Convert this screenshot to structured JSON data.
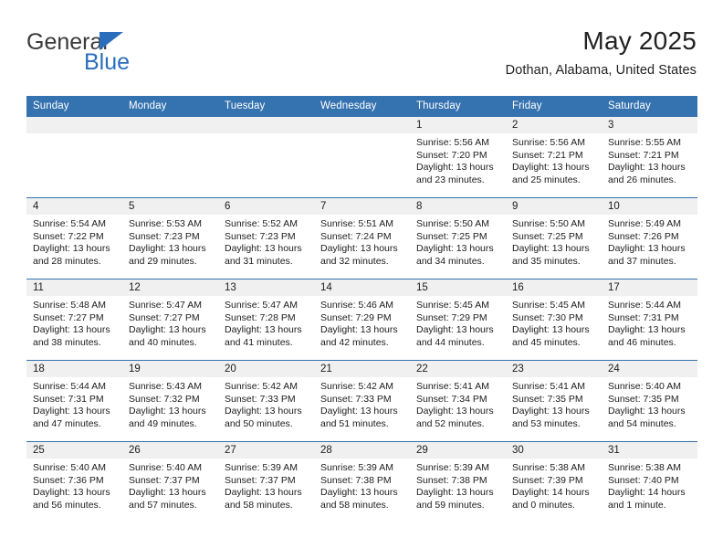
{
  "brand": {
    "name_top": "General",
    "name_bottom": "Blue",
    "accent_color": "#2a6ebb"
  },
  "header": {
    "title": "May 2025",
    "subtitle": "Dothan, Alabama, United States",
    "header_bg": "#3572b0",
    "header_text_color": "#ffffff"
  },
  "weekdays": [
    "Sunday",
    "Monday",
    "Tuesday",
    "Wednesday",
    "Thursday",
    "Friday",
    "Saturday"
  ],
  "weeks": [
    [
      {
        "day": "",
        "sunrise": "",
        "sunset": "",
        "daylight_1": "",
        "daylight_2": ""
      },
      {
        "day": "",
        "sunrise": "",
        "sunset": "",
        "daylight_1": "",
        "daylight_2": ""
      },
      {
        "day": "",
        "sunrise": "",
        "sunset": "",
        "daylight_1": "",
        "daylight_2": ""
      },
      {
        "day": "",
        "sunrise": "",
        "sunset": "",
        "daylight_1": "",
        "daylight_2": ""
      },
      {
        "day": "1",
        "sunrise": "Sunrise: 5:56 AM",
        "sunset": "Sunset: 7:20 PM",
        "daylight_1": "Daylight: 13 hours",
        "daylight_2": "and 23 minutes."
      },
      {
        "day": "2",
        "sunrise": "Sunrise: 5:56 AM",
        "sunset": "Sunset: 7:21 PM",
        "daylight_1": "Daylight: 13 hours",
        "daylight_2": "and 25 minutes."
      },
      {
        "day": "3",
        "sunrise": "Sunrise: 5:55 AM",
        "sunset": "Sunset: 7:21 PM",
        "daylight_1": "Daylight: 13 hours",
        "daylight_2": "and 26 minutes."
      }
    ],
    [
      {
        "day": "4",
        "sunrise": "Sunrise: 5:54 AM",
        "sunset": "Sunset: 7:22 PM",
        "daylight_1": "Daylight: 13 hours",
        "daylight_2": "and 28 minutes."
      },
      {
        "day": "5",
        "sunrise": "Sunrise: 5:53 AM",
        "sunset": "Sunset: 7:23 PM",
        "daylight_1": "Daylight: 13 hours",
        "daylight_2": "and 29 minutes."
      },
      {
        "day": "6",
        "sunrise": "Sunrise: 5:52 AM",
        "sunset": "Sunset: 7:23 PM",
        "daylight_1": "Daylight: 13 hours",
        "daylight_2": "and 31 minutes."
      },
      {
        "day": "7",
        "sunrise": "Sunrise: 5:51 AM",
        "sunset": "Sunset: 7:24 PM",
        "daylight_1": "Daylight: 13 hours",
        "daylight_2": "and 32 minutes."
      },
      {
        "day": "8",
        "sunrise": "Sunrise: 5:50 AM",
        "sunset": "Sunset: 7:25 PM",
        "daylight_1": "Daylight: 13 hours",
        "daylight_2": "and 34 minutes."
      },
      {
        "day": "9",
        "sunrise": "Sunrise: 5:50 AM",
        "sunset": "Sunset: 7:25 PM",
        "daylight_1": "Daylight: 13 hours",
        "daylight_2": "and 35 minutes."
      },
      {
        "day": "10",
        "sunrise": "Sunrise: 5:49 AM",
        "sunset": "Sunset: 7:26 PM",
        "daylight_1": "Daylight: 13 hours",
        "daylight_2": "and 37 minutes."
      }
    ],
    [
      {
        "day": "11",
        "sunrise": "Sunrise: 5:48 AM",
        "sunset": "Sunset: 7:27 PM",
        "daylight_1": "Daylight: 13 hours",
        "daylight_2": "and 38 minutes."
      },
      {
        "day": "12",
        "sunrise": "Sunrise: 5:47 AM",
        "sunset": "Sunset: 7:27 PM",
        "daylight_1": "Daylight: 13 hours",
        "daylight_2": "and 40 minutes."
      },
      {
        "day": "13",
        "sunrise": "Sunrise: 5:47 AM",
        "sunset": "Sunset: 7:28 PM",
        "daylight_1": "Daylight: 13 hours",
        "daylight_2": "and 41 minutes."
      },
      {
        "day": "14",
        "sunrise": "Sunrise: 5:46 AM",
        "sunset": "Sunset: 7:29 PM",
        "daylight_1": "Daylight: 13 hours",
        "daylight_2": "and 42 minutes."
      },
      {
        "day": "15",
        "sunrise": "Sunrise: 5:45 AM",
        "sunset": "Sunset: 7:29 PM",
        "daylight_1": "Daylight: 13 hours",
        "daylight_2": "and 44 minutes."
      },
      {
        "day": "16",
        "sunrise": "Sunrise: 5:45 AM",
        "sunset": "Sunset: 7:30 PM",
        "daylight_1": "Daylight: 13 hours",
        "daylight_2": "and 45 minutes."
      },
      {
        "day": "17",
        "sunrise": "Sunrise: 5:44 AM",
        "sunset": "Sunset: 7:31 PM",
        "daylight_1": "Daylight: 13 hours",
        "daylight_2": "and 46 minutes."
      }
    ],
    [
      {
        "day": "18",
        "sunrise": "Sunrise: 5:44 AM",
        "sunset": "Sunset: 7:31 PM",
        "daylight_1": "Daylight: 13 hours",
        "daylight_2": "and 47 minutes."
      },
      {
        "day": "19",
        "sunrise": "Sunrise: 5:43 AM",
        "sunset": "Sunset: 7:32 PM",
        "daylight_1": "Daylight: 13 hours",
        "daylight_2": "and 49 minutes."
      },
      {
        "day": "20",
        "sunrise": "Sunrise: 5:42 AM",
        "sunset": "Sunset: 7:33 PM",
        "daylight_1": "Daylight: 13 hours",
        "daylight_2": "and 50 minutes."
      },
      {
        "day": "21",
        "sunrise": "Sunrise: 5:42 AM",
        "sunset": "Sunset: 7:33 PM",
        "daylight_1": "Daylight: 13 hours",
        "daylight_2": "and 51 minutes."
      },
      {
        "day": "22",
        "sunrise": "Sunrise: 5:41 AM",
        "sunset": "Sunset: 7:34 PM",
        "daylight_1": "Daylight: 13 hours",
        "daylight_2": "and 52 minutes."
      },
      {
        "day": "23",
        "sunrise": "Sunrise: 5:41 AM",
        "sunset": "Sunset: 7:35 PM",
        "daylight_1": "Daylight: 13 hours",
        "daylight_2": "and 53 minutes."
      },
      {
        "day": "24",
        "sunrise": "Sunrise: 5:40 AM",
        "sunset": "Sunset: 7:35 PM",
        "daylight_1": "Daylight: 13 hours",
        "daylight_2": "and 54 minutes."
      }
    ],
    [
      {
        "day": "25",
        "sunrise": "Sunrise: 5:40 AM",
        "sunset": "Sunset: 7:36 PM",
        "daylight_1": "Daylight: 13 hours",
        "daylight_2": "and 56 minutes."
      },
      {
        "day": "26",
        "sunrise": "Sunrise: 5:40 AM",
        "sunset": "Sunset: 7:37 PM",
        "daylight_1": "Daylight: 13 hours",
        "daylight_2": "and 57 minutes."
      },
      {
        "day": "27",
        "sunrise": "Sunrise: 5:39 AM",
        "sunset": "Sunset: 7:37 PM",
        "daylight_1": "Daylight: 13 hours",
        "daylight_2": "and 58 minutes."
      },
      {
        "day": "28",
        "sunrise": "Sunrise: 5:39 AM",
        "sunset": "Sunset: 7:38 PM",
        "daylight_1": "Daylight: 13 hours",
        "daylight_2": "and 58 minutes."
      },
      {
        "day": "29",
        "sunrise": "Sunrise: 5:39 AM",
        "sunset": "Sunset: 7:38 PM",
        "daylight_1": "Daylight: 13 hours",
        "daylight_2": "and 59 minutes."
      },
      {
        "day": "30",
        "sunrise": "Sunrise: 5:38 AM",
        "sunset": "Sunset: 7:39 PM",
        "daylight_1": "Daylight: 14 hours",
        "daylight_2": "and 0 minutes."
      },
      {
        "day": "31",
        "sunrise": "Sunrise: 5:38 AM",
        "sunset": "Sunset: 7:40 PM",
        "daylight_1": "Daylight: 14 hours",
        "daylight_2": "and 1 minute."
      }
    ]
  ]
}
